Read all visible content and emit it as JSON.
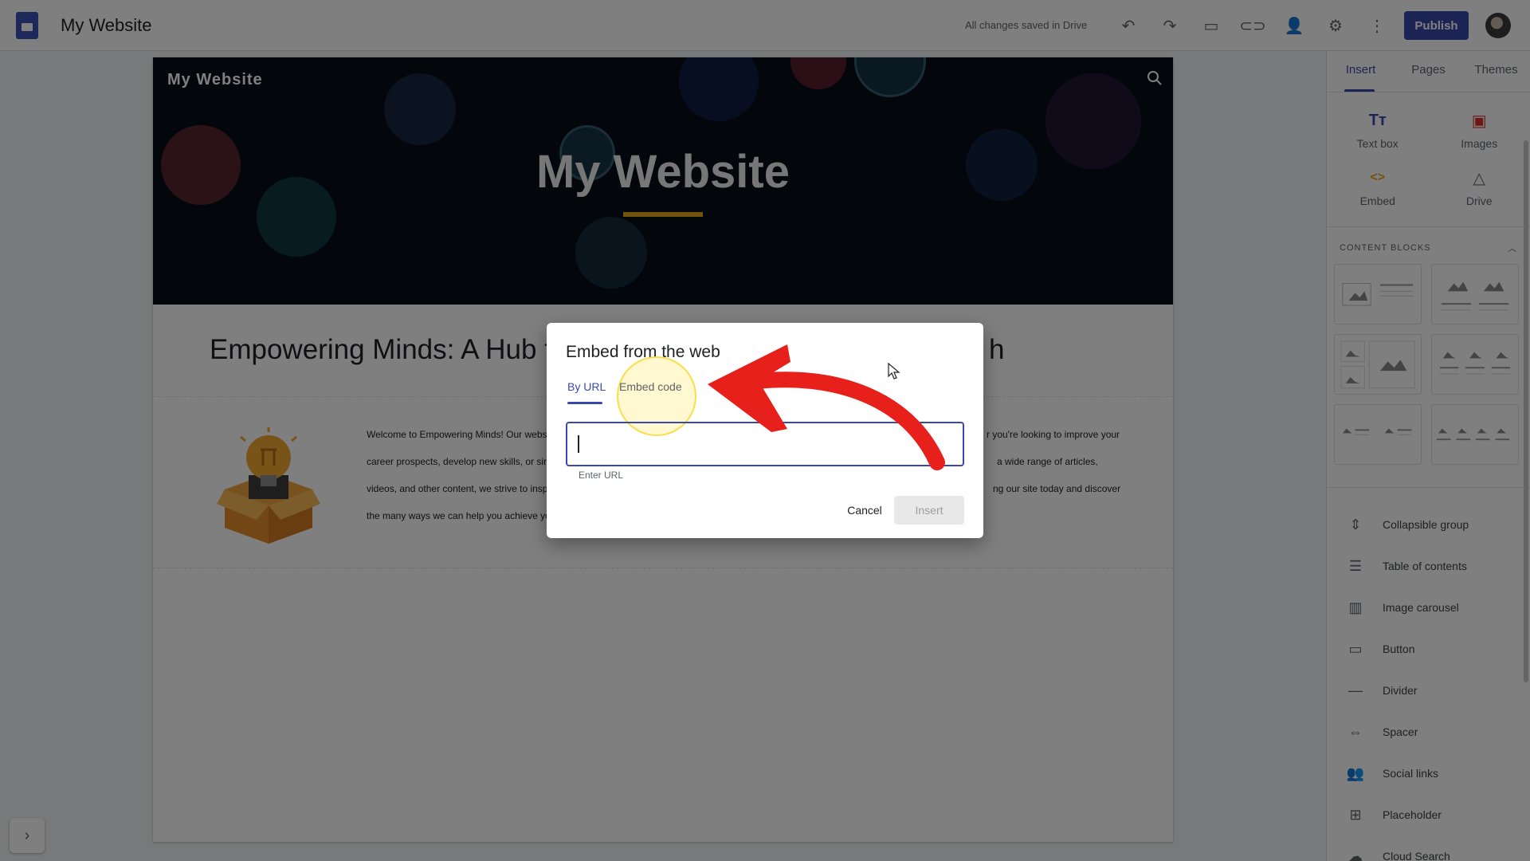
{
  "app": {
    "title": "My Website",
    "save_status": "All changes saved in Drive",
    "publish_label": "Publish"
  },
  "site": {
    "nav_title": "My Website",
    "hero_title": "My Website",
    "heading": "Empowering Minds: A Hub f",
    "heading_tail": "h",
    "body_lines": [
      "Welcome to Empowering Minds! Our webs",
      "career prospects, develop new skills, or sim",
      "videos, and other content, we strive to insp",
      "the many ways we can help you achieve yo"
    ],
    "body_lines_right": [
      "r you're looking to improve your",
      "a wide range of articles,",
      "ng our site today and discover",
      ""
    ]
  },
  "panel": {
    "tabs": [
      {
        "label": "Insert"
      },
      {
        "label": "Pages"
      },
      {
        "label": "Themes"
      }
    ],
    "insert_items": [
      {
        "label": "Text box",
        "icon": "text-box-icon",
        "glyph": "Tт",
        "color": "#3949ab"
      },
      {
        "label": "Images",
        "icon": "image-icon",
        "glyph": "▣",
        "color": "#d93025"
      },
      {
        "label": "Embed",
        "icon": "embed-icon",
        "glyph": "<>",
        "color": "#e3a617"
      },
      {
        "label": "Drive",
        "icon": "drive-icon",
        "glyph": "△",
        "color": "#5f6368"
      }
    ],
    "content_blocks_label": "CONTENT BLOCKS",
    "elements": [
      {
        "label": "Collapsible group",
        "icon": "collapsible-group-icon",
        "glyph": "⇕"
      },
      {
        "label": "Table of contents",
        "icon": "table-of-contents-icon",
        "glyph": "☰"
      },
      {
        "label": "Image carousel",
        "icon": "image-carousel-icon",
        "glyph": "▥"
      },
      {
        "label": "Button",
        "icon": "button-icon",
        "glyph": "▭"
      },
      {
        "label": "Divider",
        "icon": "divider-icon",
        "glyph": "—"
      },
      {
        "label": "Spacer",
        "icon": "spacer-icon",
        "glyph": "⇔"
      },
      {
        "label": "Social links",
        "icon": "social-links-icon",
        "glyph": "👥"
      },
      {
        "label": "Placeholder",
        "icon": "placeholder-icon",
        "glyph": "⊞"
      },
      {
        "label": "Cloud Search",
        "icon": "cloud-search-icon",
        "glyph": "☁"
      }
    ]
  },
  "dialog": {
    "title": "Embed from the web",
    "tab_url": "By URL",
    "tab_code": "Embed code",
    "input_value": "",
    "helper": "Enter URL",
    "cancel": "Cancel",
    "insert": "Insert"
  },
  "colors": {
    "accent": "#3949ab",
    "arrow": "#e8201b",
    "highlight": "#f7dc3c"
  }
}
